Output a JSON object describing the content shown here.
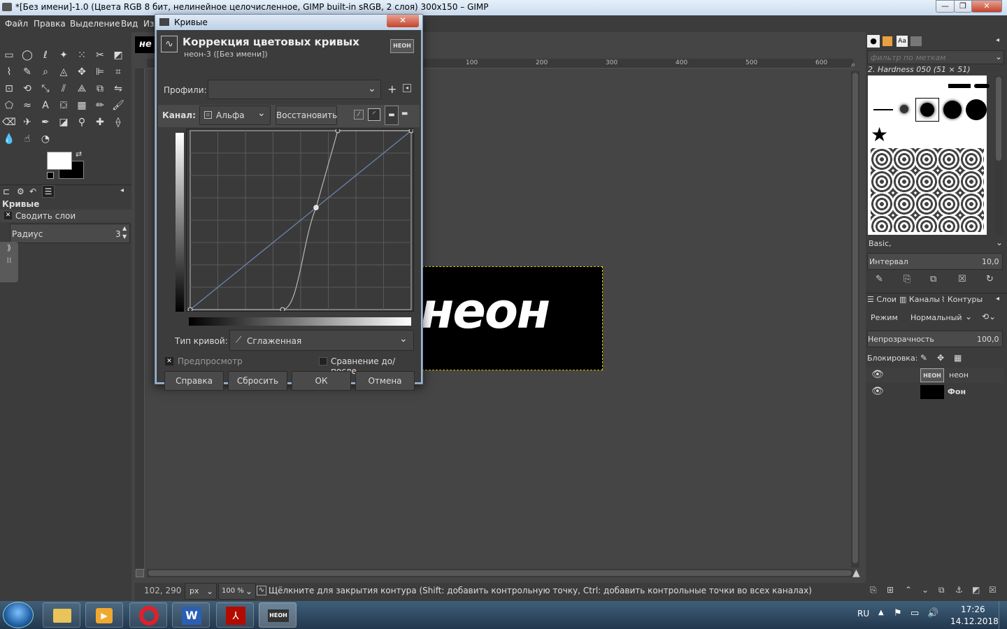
{
  "window": {
    "title": "*[Без имени]-1.0 (Цвета RGB 8 бит, нелинейное целочисленное, GIMP built-in sRGB, 2 слоя) 300x150 – GIMP",
    "minimize": "—",
    "maximize": "❐",
    "close": "✕"
  },
  "menu": [
    "Файл",
    "Правка",
    "Выделение",
    "Вид",
    "Из"
  ],
  "tool_options": {
    "title": "Кривые",
    "merge_label": "Сводить слои",
    "radius_label": "Радиус",
    "radius_value": "3"
  },
  "canvas": {
    "image_text": "неон",
    "partial_label": "неон",
    "ruler_ticks": [
      "100",
      "200",
      "300",
      "400",
      "500",
      "600"
    ]
  },
  "dialog": {
    "window_title": "Кривые",
    "heading": "Коррекция цветовых кривых",
    "subheading": "неон-3 ([Без имени])",
    "close": "✕",
    "thumb": "НЕОН",
    "profiles_label": "Профили:",
    "profiles_value": "",
    "channel_label": "Канал:",
    "channel_value": "Альфа",
    "reset_channel": "Восстановить",
    "curve_type_label": "Тип кривой:",
    "curve_type_value": "Сглаженная",
    "preview_label": "Предпросмотр",
    "compare_label": "Сравнение до/после",
    "buttons": {
      "help": "Справка",
      "reset": "Сбросить",
      "ok": "ОК",
      "cancel": "Отмена"
    }
  },
  "right_panel": {
    "filter_placeholder": "фильтр по меткам",
    "brush_name": "2. Hardness 050 (51 × 51)",
    "brush_set": "Basic,",
    "interval_label": "Интервал",
    "interval_value": "10,0",
    "tabs": [
      "Слои",
      "Каналы",
      "Контуры"
    ],
    "mode_label": "Режим",
    "mode_value": "Нормальный",
    "opacity_label": "Непрозрачность",
    "opacity_value": "100,0",
    "lock_label": "Блокировка:",
    "layers": [
      {
        "name": "неон",
        "thumb": "НЕОН"
      },
      {
        "name": "Фон",
        "thumb": ""
      }
    ]
  },
  "status": {
    "coords": "102, 290",
    "unit": "px",
    "zoom": "100 %",
    "message": "Щёлкните для закрытия контура (Shift: добавить контрольную точку, Ctrl: добавить контрольные точки во всех каналах)"
  },
  "taskbar": {
    "lang": "RU",
    "time": "17:26",
    "date": "14.12.2018",
    "gimp_thumb": "НЕОН"
  }
}
